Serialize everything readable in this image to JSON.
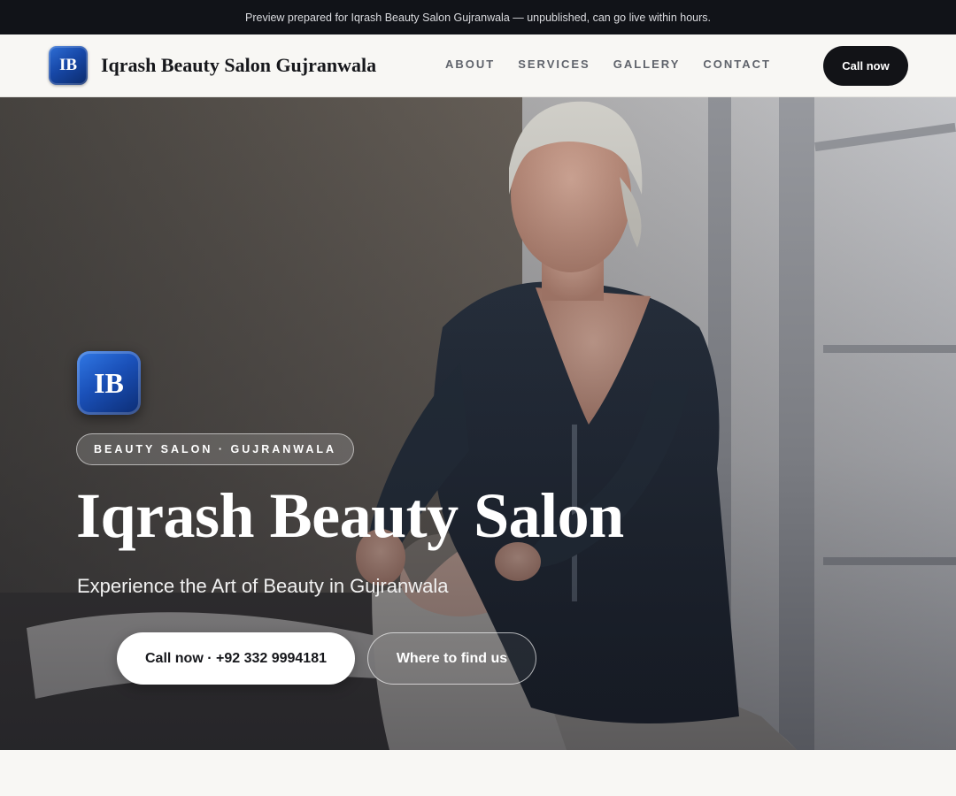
{
  "preview_banner": {
    "text": "Preview prepared for Iqrash Beauty Salon Gujranwala — unpublished, can go live within hours."
  },
  "header": {
    "logo_initials": "IB",
    "brand_name": "Iqrash Beauty Salon Gujranwala",
    "nav": [
      {
        "label": "ABOUT"
      },
      {
        "label": "SERVICES"
      },
      {
        "label": "GALLERY"
      },
      {
        "label": "CONTACT"
      }
    ],
    "cta_label": "Call now"
  },
  "hero": {
    "badge_initials": "IB",
    "eyebrow": "BEAUTY SALON · GUJRANWALA",
    "title": "Iqrash Beauty Salon",
    "subtitle": "Experience the Art of Beauty in Gujranwala",
    "primary_button": "Call now · +92 332 9994181",
    "secondary_button": "Where to find us",
    "background_image_icon": "photo-salon-treatment"
  },
  "colors": {
    "banner_bg": "#111318",
    "header_bg": "#f8f7f4",
    "brand_blue": "#1a50b8",
    "cta_dark": "#121317",
    "hero_text": "#ffffff"
  }
}
